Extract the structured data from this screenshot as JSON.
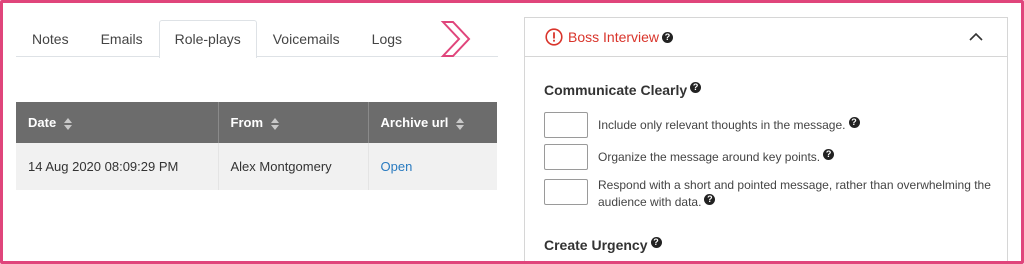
{
  "tabs": [
    "Notes",
    "Emails",
    "Role-plays",
    "Voicemails",
    "Logs"
  ],
  "active_tab": "Role-plays",
  "table": {
    "headers": [
      "Date",
      "From",
      "Archive url"
    ],
    "rows": [
      {
        "date": "14 Aug 2020 08:09:29 PM",
        "from": "Alex Montgomery",
        "archive": "Open"
      }
    ]
  },
  "panel": {
    "title": "Boss Interview",
    "sections": [
      {
        "title": "Communicate Clearly",
        "items": [
          "Include only relevant thoughts in the message.",
          "Organize the message around key points.",
          "Respond with a short and pointed message, rather than overwhelming the audience with data."
        ]
      },
      {
        "title": "Create Urgency",
        "items": []
      }
    ]
  },
  "colors": {
    "accent": "#e0457b",
    "alert": "#d9342b",
    "header": "#6c6c6c",
    "link": "#2a7bc0"
  },
  "icons": {
    "alert": "exclamation-circle-icon",
    "help": "question-circle-icon",
    "collapse": "chevron-up-icon",
    "sort": "sort-icon",
    "next": "chevron-right-icon"
  }
}
